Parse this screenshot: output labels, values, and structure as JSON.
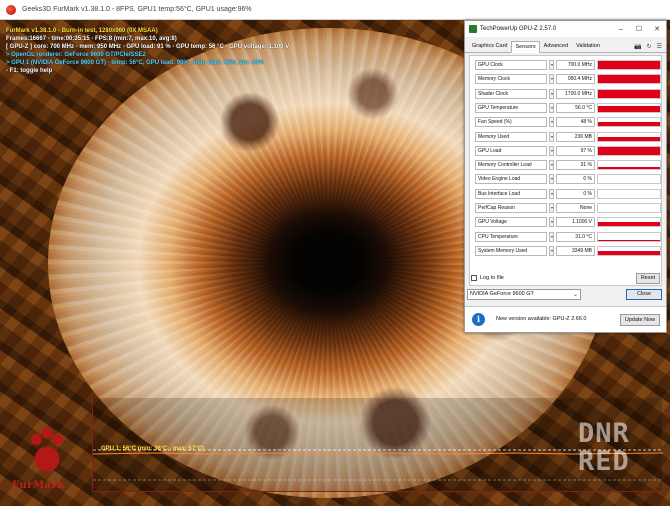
{
  "furmark": {
    "title": "Geeks3D FurMark v1.38.1.0 - 8FPS, GPU1 temp:56°C, GPU1 usage:96%",
    "overlay_lines": [
      {
        "text": "FurMark v1.38.1.0 - Burn-in test, 1280x960 (0X MSAA)",
        "color": "yellow"
      },
      {
        "text": "Frames:16667 - time:00:35:15 - FPS:8 (min:7, max:10, avg:8)",
        "color": "white"
      },
      {
        "text": "[ GPU-Z ] core: 700 MHz - mem: 950 MHz - GPU load: 91 % - GPU temp: 56 °C - GPU voltage: 1.100 V",
        "color": "white"
      },
      {
        "text": "> OpenGL renderer: GeForce 9600 GT/PCIe/SSE2",
        "color": "cyan"
      },
      {
        "text": "> GPU 1 (NVIDIA GeForce 9600 GT) - temp: 56°C, GPU load: 98%, mem load: 46%, fan: 48%",
        "color": "cyan"
      },
      {
        "text": "- F1: toggle help",
        "color": "white"
      }
    ],
    "graph_label": "GPU 1: 56°C (min: 36°C - max: 57°C)",
    "logo_text": "FurMark",
    "watermark": "DNR RED"
  },
  "gpuz": {
    "title": "TechPowerUp GPU-Z 2.57.0",
    "tabs": [
      "Graphics Card",
      "Sensors",
      "Advanced",
      "Validation"
    ],
    "active_tab": "Sensors",
    "tool_icons": [
      "camera-icon",
      "refresh-icon",
      "menu-icon"
    ],
    "sensors": [
      {
        "label": "GPU Clock",
        "value": "700.0 MHz",
        "level": 1.0
      },
      {
        "label": "Memory Clock",
        "value": "950.4 MHz",
        "level": 1.0
      },
      {
        "label": "Shader Clock",
        "value": "1700.0 MHz",
        "level": 1.0
      },
      {
        "label": "GPU Temperature",
        "value": "56.0 °C",
        "level": 0.75
      },
      {
        "label": "Fan Speed (%)",
        "value": "48 %",
        "level": 0.48
      },
      {
        "label": "Memory Used",
        "value": "236 MB",
        "level": 0.46
      },
      {
        "label": "GPU Load",
        "value": "97 %",
        "level": 0.97
      },
      {
        "label": "Memory Controller Load",
        "value": "31 %",
        "level": 0.31
      },
      {
        "label": "Video Engine Load",
        "value": "0 %",
        "level": 0.0
      },
      {
        "label": "Bus Interface Load",
        "value": "0 %",
        "level": 0.0
      },
      {
        "label": "PerfCap Reason",
        "value": "None",
        "level": 0.0
      },
      {
        "label": "GPU Voltage",
        "value": "1.1000 V",
        "level": 0.5
      },
      {
        "label": "CPU Temperature",
        "value": "31.0 °C",
        "level": 0.08
      },
      {
        "label": "System Memory Used",
        "value": "3349 MB",
        "level": 0.55
      }
    ],
    "log_to_file_label": "Log to file",
    "reset_label": "Reset",
    "gpu_select_value": "NVIDIA GeForce 9600 GT",
    "close_label": "Close",
    "notification": "New version available: GPU-Z 2.66.0",
    "update_label": "Update Now"
  }
}
